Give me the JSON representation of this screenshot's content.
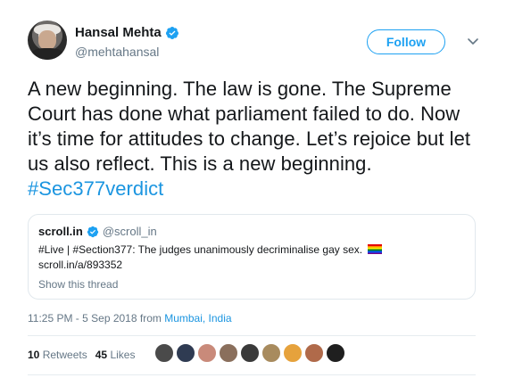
{
  "author": {
    "display_name": "Hansal Mehta",
    "handle": "@mehtahansal",
    "verified_icon": "verified-badge-icon"
  },
  "actions": {
    "follow_label": "Follow",
    "caret_icon": "chevron-down-icon"
  },
  "tweet": {
    "text_main": "A new beginning. The law is gone. The Supreme Court has done what parliament failed to do. Now it’s time for attitudes to change. Let’s rejoice but let us also reflect. This is a new beginning. ",
    "hashtag": "#Sec377verdict"
  },
  "quote": {
    "name": "scroll.in",
    "handle": "@scroll_in",
    "text": "#Live | #Section377:  The judges unanimously decriminalise gay sex.",
    "emoji_icon": "rainbow-flag-icon",
    "link": "scroll.in/a/893352",
    "show_thread": "Show this thread"
  },
  "meta": {
    "timestamp": "11:25 PM - 5 Sep 2018 from ",
    "location": "Mumbai, India"
  },
  "stats": {
    "retweets_count": "10",
    "retweets_label": "Retweets",
    "likes_count": "45",
    "likes_label": "Likes"
  },
  "likers": [
    {
      "name": "liker-avatar-1",
      "color": "#4a4a4a"
    },
    {
      "name": "liker-avatar-2",
      "color": "#2f3b52"
    },
    {
      "name": "liker-avatar-3",
      "color": "#c98a7a"
    },
    {
      "name": "liker-avatar-4",
      "color": "#8a6f5c"
    },
    {
      "name": "liker-avatar-5",
      "color": "#3a3a3a"
    },
    {
      "name": "liker-avatar-6",
      "color": "#a88b5e"
    },
    {
      "name": "liker-avatar-7",
      "color": "#e6a23c"
    },
    {
      "name": "liker-avatar-8",
      "color": "#b06a4a"
    },
    {
      "name": "liker-avatar-9",
      "color": "#1f1f1f"
    }
  ],
  "colors": {
    "accent": "#1da1f2",
    "link": "#1b95e0",
    "secondary_text": "#657786",
    "primary_text": "#14171a"
  }
}
